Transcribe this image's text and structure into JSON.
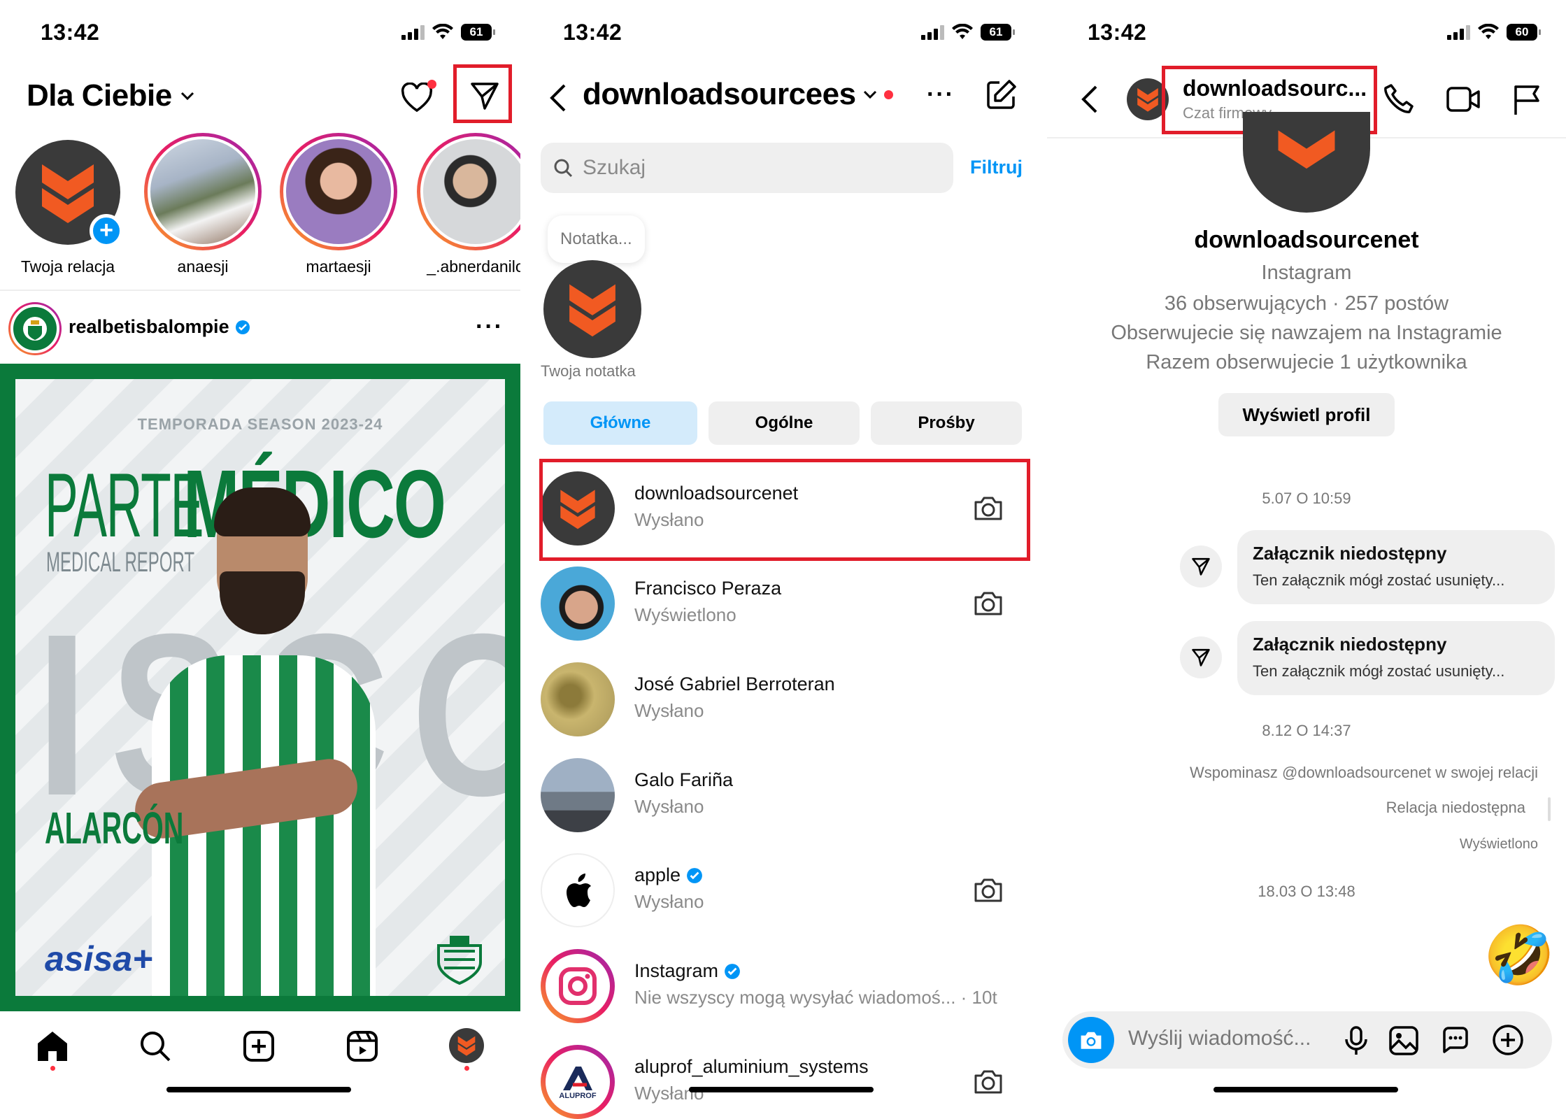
{
  "status_bar": {
    "time": "13:42",
    "battery": [
      "61",
      "61",
      "60"
    ]
  },
  "feed": {
    "title": "Dla Ciebie",
    "stories": [
      {
        "label": "Twoja relacja"
      },
      {
        "label": "anaesji"
      },
      {
        "label": "martaesji"
      },
      {
        "label": "_.abnerdanilo"
      }
    ],
    "post": {
      "username": "realbetisbalompie",
      "season": "TEMPORADA SEASON 2023-24",
      "headline_1": "PARTE",
      "headline_2": "MÉDICO",
      "subtitle": "MEDICAL REPORT",
      "player": "ISCO",
      "player_surname": "ALARCÓN",
      "sponsor": "asisa"
    }
  },
  "inbox": {
    "account": "downloadsourcees",
    "search_placeholder": "Szukaj",
    "filter_label": "Filtruj",
    "note_placeholder": "Notatka...",
    "note_label": "Twoja notatka",
    "tabs": [
      "Główne",
      "Ogólne",
      "Prośby"
    ],
    "chats": [
      {
        "name": "downloadsourcenet",
        "sub": "Wysłano",
        "verified": false
      },
      {
        "name": "Francisco Peraza",
        "sub": "Wyświetlono",
        "verified": false
      },
      {
        "name": "José Gabriel Berroteran",
        "sub": "Wysłano",
        "verified": false
      },
      {
        "name": "Galo Fariña",
        "sub": "Wysłano",
        "verified": false
      },
      {
        "name": "apple",
        "sub": "Wysłano",
        "verified": true
      },
      {
        "name": "Instagram",
        "sub": "Nie wszyscy mogą wysyłać wiadomoś... · 10t",
        "verified": true
      },
      {
        "name": "aluprof_aluminium_systems",
        "sub": "Wysłano",
        "verified": false,
        "avatar_text": "ALUPROF"
      }
    ]
  },
  "chat": {
    "header_name": "downloadsourc...",
    "header_sub": "Czat firmowy",
    "profile_name": "downloadsourcenet",
    "profile_platform": "Instagram",
    "profile_stats": "36 obserwujących · 257 postów",
    "profile_mutual": "Obserwujecie się nawzajem na Instagramie",
    "profile_common": "Razem obserwujecie 1 użytkownika",
    "view_profile": "Wyświetl profil",
    "timestamp_1": "5.07 O 10:59",
    "attachment_title": "Załącznik niedostępny",
    "attachment_sub": "Ten załącznik mógł zostać usunięty...",
    "timestamp_2": "8.12 O 14:37",
    "mention": "Wspominasz @downloadsourcenet w swojej relacji",
    "story_unavailable": "Relacja niedostępna",
    "seen": "Wyświetlono",
    "timestamp_3": "18.03 O 13:48",
    "emoji": "🤣",
    "input_placeholder": "Wyślij wiadomość..."
  },
  "colors": {
    "brand_orange": "#f15a22",
    "highlight": "#e11d2a",
    "blue": "#0095f6",
    "betis_green": "#0b7a3b"
  }
}
